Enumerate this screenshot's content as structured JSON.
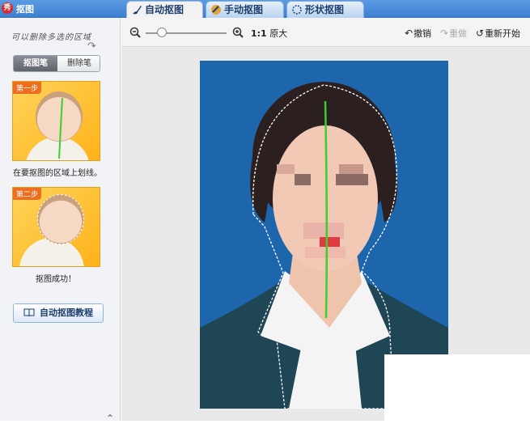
{
  "app": {
    "title": "抠图",
    "icon": "app-logo-icon"
  },
  "tabs": [
    {
      "label": "自动抠图",
      "icon": "brush-icon",
      "active": true
    },
    {
      "label": "手动抠图",
      "icon": "hand-brush-icon",
      "active": false
    },
    {
      "label": "形状抠图",
      "icon": "shape-icon",
      "active": false
    }
  ],
  "left": {
    "hint": "可以删除多选的区域",
    "modes": {
      "selected": "抠图笔",
      "other": "删除笔"
    },
    "steps": [
      {
        "badge": "第一步",
        "caption": "在要抠图的区域上划线。"
      },
      {
        "badge": "第二步",
        "caption": "抠图成功！"
      }
    ],
    "tutorial_button": "自动抠图教程"
  },
  "toolbar": {
    "zoom_ratio_bold": "1:1",
    "zoom_ratio_label": "原大",
    "undo": "撤销",
    "redo": "重做",
    "restart": "重新开始",
    "zoom_level": 0.2
  },
  "colors": {
    "accent": "#3f7fd1",
    "stroke": "#3ccf2e",
    "photo_bg": "#1e66ab"
  }
}
